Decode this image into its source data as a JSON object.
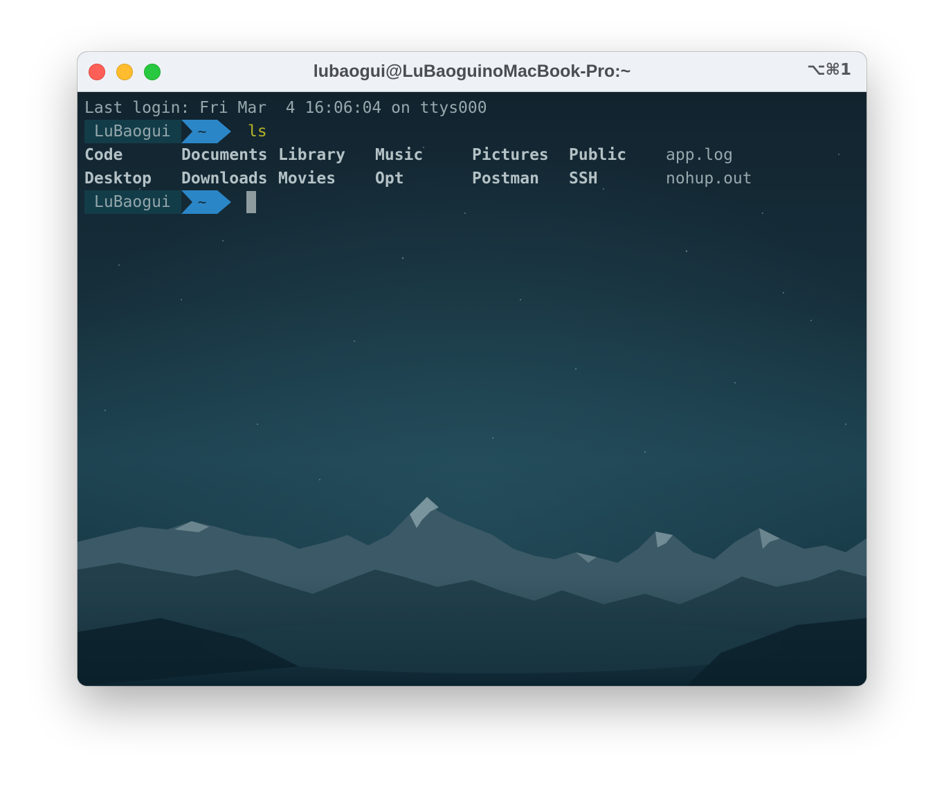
{
  "window": {
    "title": "lubaogui@LuBaoguinoMacBook-Pro:~",
    "shortcut": "⌥⌘1"
  },
  "terminal": {
    "login_line": "Last login: Fri Mar  4 16:06:04 on ttys000",
    "prompt_user": "LuBaogui",
    "prompt_dir": "~",
    "command": "ls",
    "listing": {
      "row1": [
        "Code",
        "Documents",
        "Library",
        "Music",
        "Pictures",
        "Public",
        "app.log"
      ],
      "row2": [
        "Desktop",
        "Downloads",
        "Movies",
        "Opt",
        "Postman",
        "SSH",
        "nohup.out"
      ]
    }
  },
  "colors": {
    "prompt_user_bg": "#123c48",
    "prompt_dir_bg": "#2b86c7",
    "command_fg": "#b7b428",
    "text_fg": "#98a8ad"
  }
}
